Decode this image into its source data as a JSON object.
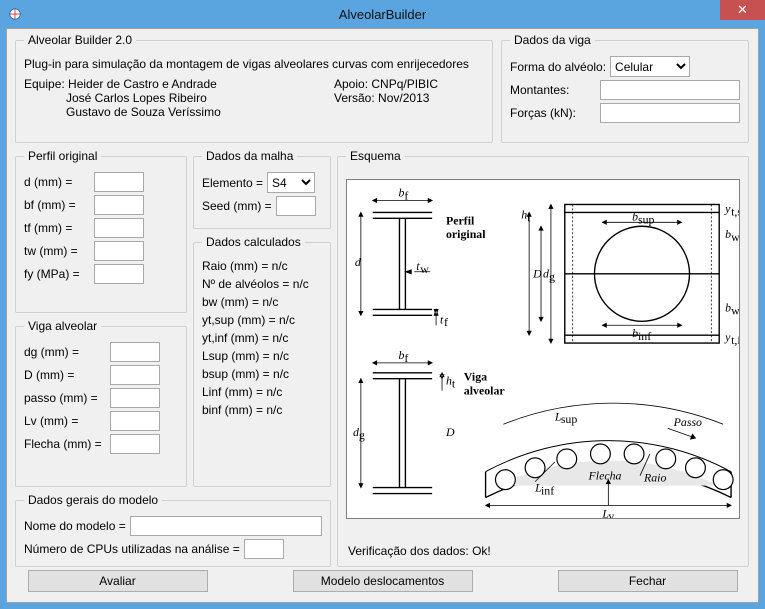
{
  "window": {
    "title": "AlveolarBuilder"
  },
  "header": {
    "legend": "Alveolar Builder 2.0",
    "desc": "Plug-in para simulação da montagem de vigas alveolares curvas com enrijecedores",
    "equipe_label": "Equipe:",
    "equipe1": "Heider de Castro e Andrade",
    "equipe2": "José Carlos Lopes Ribeiro",
    "equipe3": "Gustavo de Souza Veríssimo",
    "apoio_label": "Apoio:",
    "apoio": "CNPq/PIBIC",
    "versao_label": "Versão:",
    "versao": "Nov/2013"
  },
  "dados_viga": {
    "legend": "Dados da viga",
    "forma_label": "Forma do alvéolo:",
    "forma_value": "Celular",
    "montantes_label": "Montantes:",
    "montantes_value": "",
    "forcas_label": "Forças (kN):",
    "forcas_value": ""
  },
  "perfil_orig": {
    "legend": "Perfil original",
    "d_label": "d (mm) =",
    "d_value": "",
    "bf_label": "bf (mm) =",
    "bf_value": "",
    "tf_label": "tf (mm) =",
    "tf_value": "",
    "tw_label": "tw (mm) =",
    "tw_value": "",
    "fy_label": "fy (MPa) =",
    "fy_value": ""
  },
  "viga_alv": {
    "legend": "Viga alveolar",
    "dg_label": "dg (mm) =",
    "dg_value": "",
    "D_label": "D (mm) =",
    "D_value": "",
    "passo_label": "passo (mm) =",
    "passo_value": "",
    "Lv_label": "Lv (mm) =",
    "Lv_value": "",
    "flecha_label": "Flecha (mm) =",
    "flecha_value": ""
  },
  "dados_gerais": {
    "legend": "Dados gerais do modelo",
    "nome_label": "Nome do modelo =",
    "nome_value": "",
    "cpus_label": "Número de CPUs utilizadas na análise =",
    "cpus_value": ""
  },
  "dados_malha": {
    "legend": "Dados da malha",
    "elemento_label": "Elemento =",
    "elemento_value": "S4",
    "seed_label": "Seed (mm) =",
    "seed_value": ""
  },
  "dados_calc": {
    "legend": "Dados calculados",
    "raio": "Raio (mm) = n/c",
    "nalv": "Nº de alvéolos = n/c",
    "bw": "bw (mm) = n/c",
    "ytsup": "yt,sup (mm) = n/c",
    "ytinf": "yt,inf (mm) = n/c",
    "lsup": "Lsup (mm) = n/c",
    "bsup": "bsup (mm) = n/c",
    "linf": "Linf (mm) = n/c",
    "binf": "binf (mm) = n/c"
  },
  "esquema": {
    "legend": "Esquema",
    "verif": "Verificação dos dados: Ok!",
    "lbl_perfil": "Perfil",
    "lbl_original": "original",
    "lbl_viga": "Viga",
    "lbl_alveolar": "alveolar"
  },
  "buttons": {
    "avaliar": "Avaliar",
    "modelo": "Modelo deslocamentos",
    "fechar": "Fechar"
  }
}
